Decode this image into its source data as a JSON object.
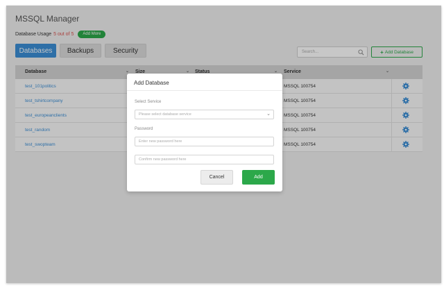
{
  "app": {
    "title": "MSSQL Manager",
    "usage_label": "Database Usage",
    "usage_value": "5 out of 5",
    "add_more_label": "Add More"
  },
  "tabs": [
    {
      "label": "Databases",
      "active": true
    },
    {
      "label": "Backups",
      "active": false
    },
    {
      "label": "Security",
      "active": false
    }
  ],
  "toolbar": {
    "search_placeholder": "Search...",
    "add_database_label": "Add Database"
  },
  "table": {
    "headers": [
      "Database",
      "Size",
      "Status",
      "Service"
    ],
    "rows": [
      {
        "name": "test_101politics",
        "service": "MSSQL 100754"
      },
      {
        "name": "test_tshirtcompany",
        "service": "MSSQL 100754"
      },
      {
        "name": "test_europeanclients",
        "service": "MSSQL 100754"
      },
      {
        "name": "test_random",
        "service": "MSSQL 100754"
      },
      {
        "name": "test_swopteam",
        "service": "MSSQL 100754"
      }
    ]
  },
  "modal": {
    "title": "Add Database",
    "select_service_label": "Select Service",
    "select_service_placeholder": "Please select database service",
    "password_label": "Password",
    "password_placeholder": "Enter new password here",
    "confirm_placeholder": "Confirm new password here",
    "cancel_label": "Cancel",
    "add_label": "Add"
  },
  "colors": {
    "accent": "#3c8fd6",
    "success": "#2ca84a",
    "danger": "#d9534f"
  }
}
